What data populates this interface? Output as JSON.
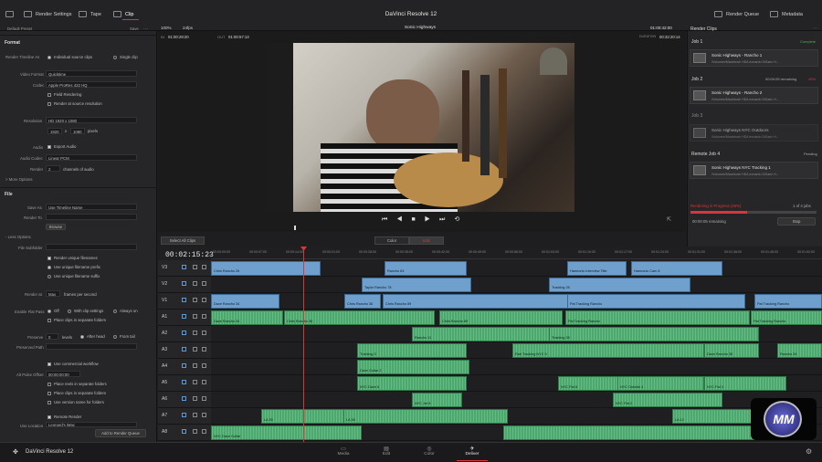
{
  "topbar": {
    "render_settings": "Render Settings",
    "tape": "Tape",
    "clip": "Clip",
    "title": "DaVinci Resolve 12",
    "render_queue": "Render Queue",
    "metadata": "Metadata"
  },
  "left": {
    "preset": "Default Preset",
    "save": "Save",
    "format_section": "Format",
    "render_timeline_as": "Render Timeline As",
    "individual_clips": "Individual source clips",
    "single_clip": "Single clip",
    "video_format_label": "Video Format",
    "video_format": "Quicktime",
    "codec_label": "Codec",
    "codec": "Apple ProRes 422 HQ",
    "field_rendering": "Field Rendering",
    "render_at_source": "Render at source resolution",
    "resolution_label": "Resolution",
    "resolution": "HD 1920 x 1080",
    "res_w": "1920",
    "res_x": "x",
    "res_h": "1080",
    "pixels": "pixels",
    "audio_label": "Audio",
    "export_audio": "Export Audio",
    "audio_codec_label": "Audio Codec",
    "audio_codec": "Linear PCM",
    "render_label": "Render",
    "render_channels_val": "2",
    "render_channels": "channels of audio",
    "more_options": "> More Options",
    "file_section": "File",
    "save_as_label": "Save As",
    "save_as": "Use Timeline Name",
    "render_to_label": "Render To",
    "browse": "Browse",
    "less_options": "- Less Options",
    "file_subfolder": "File Subfolder",
    "render_unique": "Render unique filenames",
    "unique_prefix": "Use unique filename prefix",
    "unique_suffix": "Use unique filename suffix",
    "render_at_label": "Render at",
    "render_at_val": "Max",
    "frames_per_second": "frames per second",
    "enable_flat_pass": "Enable Flat Pass",
    "off": "Off",
    "with_clip_settings": "With clip settings",
    "always_on": "Always on",
    "place_clips": "Place clips in separate folders",
    "preserve_label": "Preserve",
    "preserve_val": "0",
    "levels": "levels",
    "after_head": "After head",
    "from_tail": "From tail",
    "preserved_path": "Preserved Path",
    "use_commercial": "Use commercial workflow",
    "alt_offset_label": "Alt Pulse Offset",
    "alt_offset": "00:00:00:00",
    "place_reels": "Place reels in separate folders",
    "place_clips2": "Place clips in separate folders",
    "use_version": "Use version name for folders",
    "remote_render": "Remote Render",
    "use_location": "Use Location",
    "use_location_val": "Leonard's iMac",
    "add_to_queue": "Add to Render Queue"
  },
  "viewer": {
    "zoom": "100%",
    "fps": "24fps",
    "clip_name": "Sonic Highways",
    "tc_right": "01:00:42:00",
    "in_label": "IN",
    "in_tc": "01:00:29:20",
    "out_label": "OUT",
    "out_tc": "01:00:57:13",
    "duration_label": "DURATION",
    "duration": "00:32:20:14",
    "select_all": "Select All Clips",
    "color": "Color",
    "edit": "Edit"
  },
  "render": {
    "header": "Render Clips",
    "job1": "Job 1",
    "job1_status": "Complete",
    "job1_title": "Sonic Highways - Rancho 1",
    "job1_path": "/Volumes/Macintosh HD/Leonardo DiSaric H...",
    "job2": "Job 2",
    "job2_status": "00:00:05 remaining",
    "job2_pct": "45%",
    "job2_title": "Sonic Highways - Rancho 2",
    "job2_path": "/Volumes/Macintosh HD/Leonardo DiSaric H...",
    "job3": "Job 3",
    "job3_title": "Sonic Highways NYC Outdoors",
    "job3_path": "/Volumes/Macintosh HD/Leonardo DiSaric H...",
    "job4": "Remote Job 4",
    "job4_status": "Pending",
    "job4_title": "Sonic Highways NYC Tracking 1",
    "job4_path": "/Volumes/Macintosh HD/Leonardo DiSaric H...",
    "progress_label": "Rendering in Progress (45%)",
    "progress_jobs": "1 of 4 jobs",
    "remaining": "00:00:05 remaining",
    "stop": "Stop",
    "progress": 0.45
  },
  "timeline": {
    "timecode": "00:02:15:23",
    "ruler": [
      "00:00:00:00",
      "00:00:07:00",
      "00:00:14:00",
      "00:00:21:00",
      "00:00:28:00",
      "00:00:35:00",
      "00:00:42:00",
      "00:00:49:00",
      "00:00:56:00",
      "00:01:03:00",
      "00:01:10:00",
      "00:01:17:00",
      "00:01:24:00",
      "00:01:31:00",
      "00:01:38:00",
      "00:01:45:00",
      "00:01:52:00"
    ],
    "tracks": [
      "V3",
      "V2",
      "V1",
      "A1",
      "A2",
      "A3",
      "A4",
      "A5",
      "A6",
      "A7",
      "A8"
    ],
    "clips_v3": [
      {
        "label": "Chris Rancho 26"
      },
      {
        "label": "Rancho 63"
      },
      {
        "label": "Harmonic Interview Title"
      },
      {
        "label": "Harmonic Cam 8"
      }
    ],
    "clips_v2": [
      {
        "label": "Taylor Rancho 78"
      },
      {
        "label": "Tracking 26"
      }
    ],
    "clips_v1": [
      {
        "label": "Dave Rancho 34"
      },
      {
        "label": "Chris Rancho 36"
      },
      {
        "label": "Chris Rancho 89"
      },
      {
        "label": "Pat Tracking Rancho"
      },
      {
        "label": "Pat Tracking Rancho"
      }
    ],
    "clips_a1": [
      {
        "label": "Dave Rancho 34"
      },
      {
        "label": "Chris Rancho 36"
      },
      {
        "label": "Chris Rancho 89"
      },
      {
        "label": "Pat Tracking Rancho"
      },
      {
        "label": "Pat Tracking Rancho"
      }
    ],
    "clips_a2": [
      {
        "label": "Rancho 11"
      },
      {
        "label": "Tracking 35"
      }
    ],
    "clips_a3": [
      {
        "label": "Tracking 3"
      },
      {
        "label": "Rab Tracking NYC 9"
      },
      {
        "label": "Dave Rancho 35"
      },
      {
        "label": "Rancho 26"
      }
    ],
    "clips_a4": [
      {
        "label": "Dave Guitar 2"
      }
    ],
    "clips_a5": [
      {
        "label": "NYC Dave 6"
      },
      {
        "label": "NYC Pat 8"
      },
      {
        "label": "NYC Outside 4"
      },
      {
        "label": "NYC Pat 3"
      }
    ],
    "clips_a6": [
      {
        "label": "NYC Jet 8"
      },
      {
        "label": "NYC Pat 2"
      }
    ],
    "clips_a7": [
      {
        "label": "LA 35"
      },
      {
        "label": "LA 39"
      },
      {
        "label": "LA 12"
      }
    ],
    "clips_a8": [
      {
        "label": "NYC Dave Guitar"
      }
    ]
  },
  "bottom": {
    "app": "DaVinci Resolve 12",
    "tabs": [
      "Media",
      "Edit",
      "Color",
      "Deliver"
    ]
  },
  "colors": {
    "accent": "#d7363a",
    "video_clip": "#6f9fcd",
    "audio_clip": "#4aa96c"
  }
}
